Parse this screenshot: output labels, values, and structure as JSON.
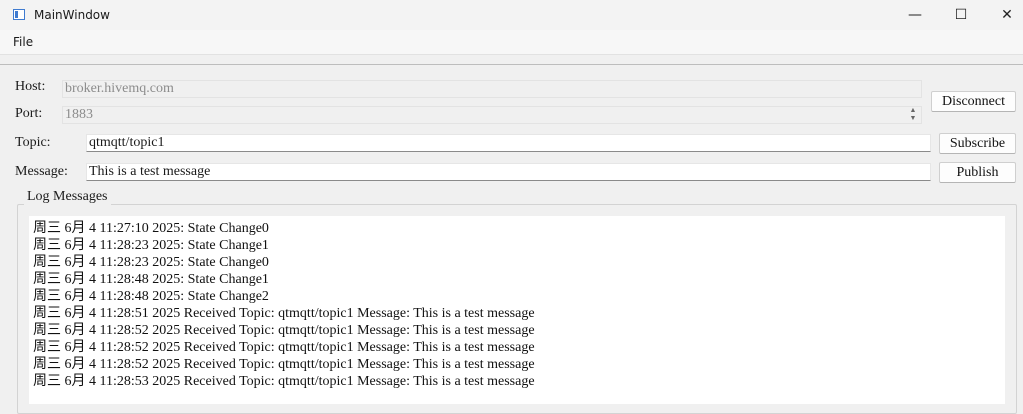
{
  "window": {
    "title": "MainWindow",
    "minimize_glyph": "—",
    "maximize_glyph": "☐",
    "close_glyph": "✕"
  },
  "menu": {
    "file_label": "File"
  },
  "form": {
    "host_label": "Host:",
    "host_value": "broker.hivemq.com",
    "port_label": "Port:",
    "port_value": "1883",
    "topic_label": "Topic:",
    "topic_value": "qtmqtt/topic1",
    "message_label": "Message:",
    "message_value": "This is a test message"
  },
  "buttons": {
    "disconnect": "Disconnect",
    "subscribe": "Subscribe",
    "publish": "Publish"
  },
  "log": {
    "title": "Log Messages",
    "lines": [
      "周三 6月 4 11:27:10 2025: State Change0",
      "周三 6月 4 11:28:23 2025: State Change1",
      "周三 6月 4 11:28:23 2025: State Change0",
      "周三 6月 4 11:28:48 2025: State Change1",
      "周三 6月 4 11:28:48 2025: State Change2",
      "周三 6月 4 11:28:51 2025 Received Topic: qtmqtt/topic1 Message: This is a test message",
      "周三 6月 4 11:28:52 2025 Received Topic: qtmqtt/topic1 Message: This is a test message",
      "周三 6月 4 11:28:52 2025 Received Topic: qtmqtt/topic1 Message: This is a test message",
      "周三 6月 4 11:28:52 2025 Received Topic: qtmqtt/topic1 Message: This is a test message",
      "周三 6月 4 11:28:53 2025 Received Topic: qtmqtt/topic1 Message: This is a test message"
    ]
  }
}
